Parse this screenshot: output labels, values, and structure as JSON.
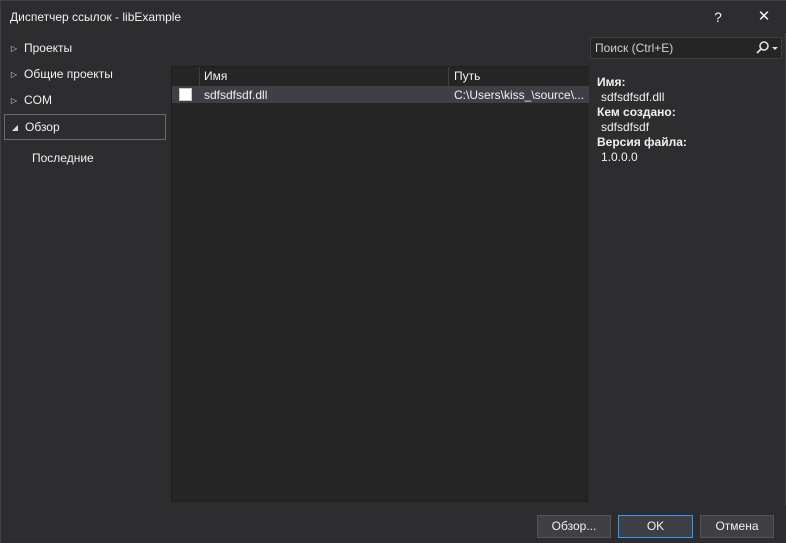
{
  "window": {
    "title": "Диспетчер ссылок - libExample",
    "help_label": "?",
    "close_label": "✕"
  },
  "nav": {
    "items": [
      {
        "label": "Проекты",
        "expanded": false
      },
      {
        "label": "Общие проекты",
        "expanded": false
      },
      {
        "label": "COM",
        "expanded": false
      },
      {
        "label": "Обзор",
        "expanded": true,
        "selected": true
      }
    ],
    "sub_items": [
      "Последние"
    ]
  },
  "search": {
    "placeholder": "Поиск (Ctrl+E)",
    "value": ""
  },
  "list": {
    "columns": [
      "Имя",
      "Путь"
    ],
    "rows": [
      {
        "checked": false,
        "name": "sdfsdfsdf.dll",
        "path": "C:\\Users\\kiss_\\source\\..."
      }
    ]
  },
  "details": {
    "name_label": "Имя:",
    "name_value": "sdfsdfsdf.dll",
    "created_label": "Кем создано:",
    "created_value": "sdfsdfsdf",
    "version_label": "Версия файла:",
    "version_value": "1.0.0.0"
  },
  "buttons": {
    "browse": "Обзор...",
    "ok": "OK",
    "cancel": "Отмена"
  },
  "colors": {
    "background": "#2d2d30",
    "panel": "#252526",
    "accent": "#3399ff"
  }
}
